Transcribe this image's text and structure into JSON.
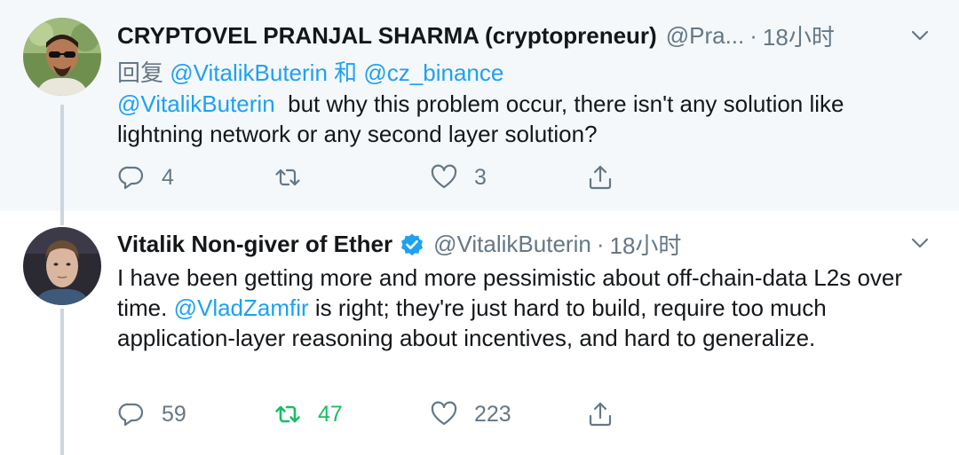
{
  "tweets": [
    {
      "name": "CRYPTOVEL PRANJAL SHARMA (cryptopreneur)",
      "handle": "@Pra...",
      "dot": "·",
      "time": "18小时",
      "reply_prefix": "回复",
      "reply_mention_1": "@VitalikButerin",
      "reply_joiner": "和",
      "reply_mention_2": "@cz_binance",
      "body_mention": "@VitalikButerin",
      "body_text": "  but why this problem occur, there isn't any solution like lightning network or any second layer solution?",
      "replies": "4",
      "retweets": "",
      "likes": "3"
    },
    {
      "name": "Vitalik Non-giver of Ether",
      "handle": "@VitalikButerin",
      "dot": "·",
      "time": "18小时",
      "body_text_1": "I have been getting more and more pessimistic about off-chain-data L2s over time. ",
      "body_mention": "@VladZamfir",
      "body_text_2": " is right; they're just hard to build, require too much application-layer reasoning about incentives, and hard to generalize.",
      "replies": "59",
      "retweets": "47",
      "likes": "223"
    }
  ],
  "colors": {
    "link": "#1da1f2",
    "muted": "#657786",
    "retweet_active": "#17bf63",
    "reply_bg": "#f5f8fa"
  },
  "icons": [
    "reply-icon",
    "retweet-icon",
    "like-icon",
    "share-icon",
    "chevron-down-icon",
    "verified-badge-icon"
  ]
}
